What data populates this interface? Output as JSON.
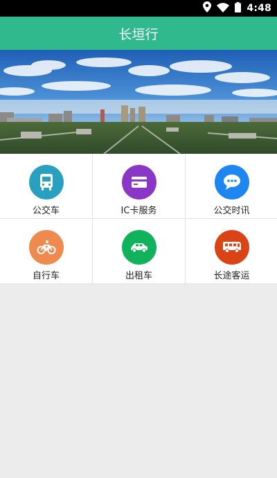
{
  "status_bar": {
    "time": "4:48",
    "icons": [
      "location-icon",
      "wifi-icon",
      "battery-icon"
    ]
  },
  "app_bar": {
    "title": "长垣行"
  },
  "banner": {
    "description_icon": "city-skyline-image"
  },
  "menu": {
    "items": [
      {
        "label": "公交车",
        "icon": "bus-icon",
        "color": "#2aa0c0"
      },
      {
        "label": "IC卡服务",
        "icon": "card-icon",
        "color": "#8a36c6"
      },
      {
        "label": "公交时讯",
        "icon": "chat-icon",
        "color": "#1d86f0"
      },
      {
        "label": "自行车",
        "icon": "bicycle-icon",
        "color": "#ee8a4e"
      },
      {
        "label": "出租车",
        "icon": "taxi-icon",
        "color": "#10b25c"
      },
      {
        "label": "长途客运",
        "icon": "coach-icon",
        "color": "#d94316"
      }
    ]
  },
  "colors": {
    "primary": "#2fb98d",
    "background": "#ececec"
  }
}
